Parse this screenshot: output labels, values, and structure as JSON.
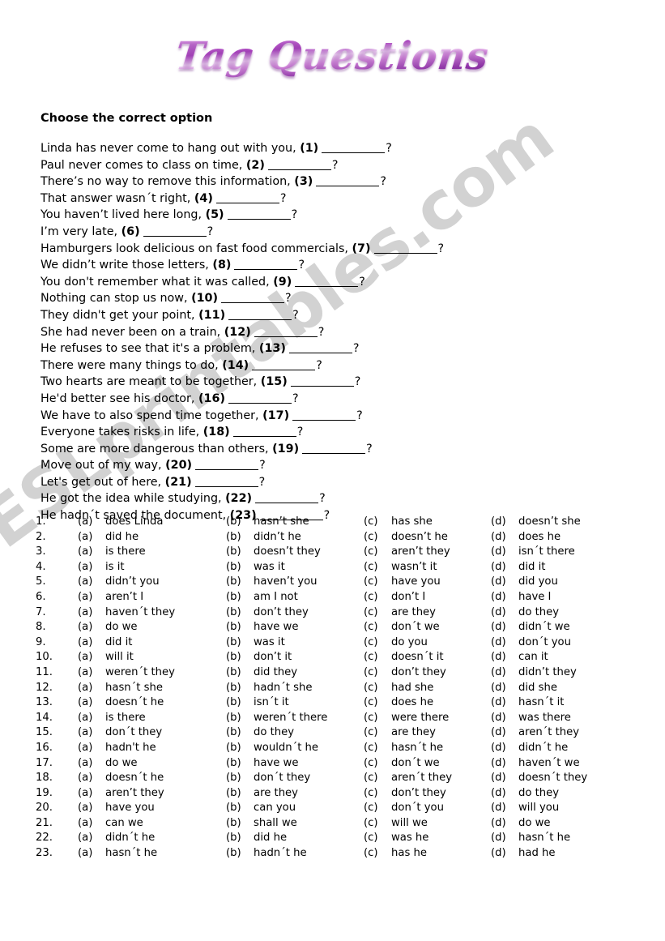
{
  "title": "Tag Questions",
  "instruction": "Choose the correct option",
  "watermark": "ESLprintables.com",
  "colors": {
    "title_light": "#e8c6ee",
    "title_mid": "#a93fbe",
    "title_dark": "#6d1f84",
    "watermark_gray": "#d2d2d2",
    "text": "#000000"
  },
  "questions": [
    {
      "num": "(1)",
      "before": "Linda has never come to hang out with you,",
      "after": "?"
    },
    {
      "num": "(2)",
      "before": "Paul never comes to class on time,",
      "after": "?"
    },
    {
      "num": "(3)",
      "before": "There’s no way to remove this information,",
      "after": "?"
    },
    {
      "num": "(4)",
      "before": "That answer wasn´t right,",
      "after": "?"
    },
    {
      "num": "(5)",
      "before": "You haven’t lived here long,",
      "after": "?"
    },
    {
      "num": "(6)",
      "before": "I’m very late,",
      "after": "?"
    },
    {
      "num": "(7)",
      "before": "Hamburgers look delicious on fast food commercials,",
      "after": "?"
    },
    {
      "num": "(8)",
      "before": "We didn’t write those letters,",
      "after": "?"
    },
    {
      "num": "(9)",
      "before": "You don't remember what it was called,",
      "after": "?"
    },
    {
      "num": "(10)",
      "before": "Nothing can stop us now,",
      "after": "?"
    },
    {
      "num": "(11)",
      "before": "They didn't  get your point,",
      "after": "?"
    },
    {
      "num": "(12)",
      "before": "She had never been on a train,",
      "after": "?"
    },
    {
      "num": "(13)",
      "before": "He refuses to see that it's a problem,",
      "after": "?"
    },
    {
      "num": "(14)",
      "before": "There were many things to do,",
      "after": "?"
    },
    {
      "num": "(15)",
      "before": "Two hearts are meant to be together,",
      "after": "?"
    },
    {
      "num": "(16)",
      "before": "He'd better see his doctor,",
      "after": "?"
    },
    {
      "num": "(17)",
      "before": "We have to also spend time together,",
      "after": "?"
    },
    {
      "num": "(18)",
      "before": "Everyone takes risks in life,",
      "after": "?"
    },
    {
      "num": "(19)",
      "before": "Some are more dangerous than others,",
      "after": "?"
    },
    {
      "num": "(20)",
      "before": "Move out of my way,",
      "after": "?"
    },
    {
      "num": "(21)",
      "before": "Let's get out of here,",
      "after": "?"
    },
    {
      "num": "(22)",
      "before": "He got the idea while studying,",
      "after": "?"
    },
    {
      "num": "(23)",
      "before": "He hadn´t saved the document,",
      "after": "?"
    }
  ],
  "option_letters": {
    "a": "(a)",
    "b": "(b)",
    "c": "(c)",
    "d": "(d)"
  },
  "options": [
    {
      "index": "1.",
      "a": "does Linda",
      "b": "hasn’t she",
      "c": "has she",
      "d": "doesn’t she"
    },
    {
      "index": "2.",
      "a": "did he",
      "b": "didn’t he",
      "c": "doesn’t he",
      "d": "does he"
    },
    {
      "index": "3.",
      "a": "is there",
      "b": "doesn’t they",
      "c": "aren’t they",
      "d": "isn´t there"
    },
    {
      "index": "4.",
      "a": "is it",
      "b": "was it",
      "c": "wasn’t it",
      "d": "did it"
    },
    {
      "index": "5.",
      "a": "didn’t you",
      "b": "haven’t you",
      "c": "have you",
      "d": "did you"
    },
    {
      "index": "6.",
      "a": "aren’t I",
      "b": "am I not",
      "c": "don’t I",
      "d": "have I"
    },
    {
      "index": "7.",
      "a": "haven´t they",
      "b": "don’t they",
      "c": "are they",
      "d": "do they"
    },
    {
      "index": "8.",
      "a": "do we",
      "b": "have we",
      "c": "don´t we",
      "d": "didn´t we"
    },
    {
      "index": "9.",
      "a": "did it",
      "b": "was it",
      "c": "do you",
      "d": "don´t you"
    },
    {
      "index": "10.",
      "a": "will it",
      "b": "don’t it",
      "c": "doesn´t it",
      "d": "can it"
    },
    {
      "index": "11.",
      "a": "weren´t they",
      "b": "did they",
      "c": "don’t they",
      "d": "didn’t they"
    },
    {
      "index": "12.",
      "a": "hasn´t she",
      "b": "hadn´t she",
      "c": "had she",
      "d": "did she"
    },
    {
      "index": "13.",
      "a": "doesn´t he",
      "b": "isn´t it",
      "c": "does he",
      "d": "hasn´t it"
    },
    {
      "index": "14.",
      "a": "is there",
      "b": "weren´t there",
      "c": "were there",
      "d": "was there"
    },
    {
      "index": "15.",
      "a": "don´t they",
      "b": "do they",
      "c": "are they",
      "d": "aren´t they"
    },
    {
      "index": "16.",
      "a": "hadn't he",
      "b": "wouldn´t he",
      "c": "hasn´t he",
      "d": "didn´t he"
    },
    {
      "index": "17.",
      "a": "do we",
      "b": "have we",
      "c": "don´t we",
      "d": "haven´t we"
    },
    {
      "index": "18.",
      "a": "doesn´t he",
      "b": "don´t they",
      "c": "aren´t they",
      "d": "doesn´t they"
    },
    {
      "index": "19.",
      "a": "aren’t they",
      "b": "are they",
      "c": "don’t they",
      "d": "do they"
    },
    {
      "index": "20.",
      "a": "have you",
      "b": "can you",
      "c": "don´t you",
      "d": "will you"
    },
    {
      "index": "21.",
      "a": "can we",
      "b": "shall we",
      "c": "will we",
      "d": "do we"
    },
    {
      "index": "22.",
      "a": "didn´t he",
      "b": "did he",
      "c": "was he",
      "d": "hasn´t he"
    },
    {
      "index": "23.",
      "a": "hasn´t he",
      "b": "hadn´t he",
      "c": "has he",
      "d": "had he"
    }
  ]
}
